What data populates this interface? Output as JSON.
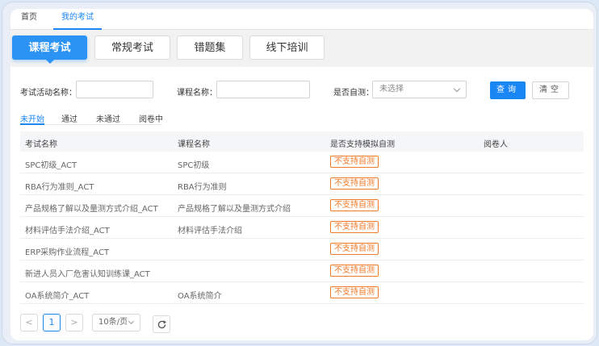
{
  "topnav": {
    "home": "首页",
    "my_exams": "我的考试"
  },
  "tabs": [
    "课程考试",
    "常规考试",
    "错题集",
    "线下培训"
  ],
  "filters": {
    "activity_name_label": "考试活动名称：",
    "course_name_label": "课程名称：",
    "self_test_label": "是否自测：",
    "self_test_value": "未选择",
    "query_button": "查询",
    "clear_button": "清空"
  },
  "subtabs": [
    "未开始",
    "通过",
    "未通过",
    "阅卷中"
  ],
  "table": {
    "headers": [
      "考试名称",
      "课程名称",
      "是否支持模拟自测",
      "阅卷人"
    ],
    "rows": [
      {
        "exam": "SPC初级_ACT",
        "course": "SPC初级",
        "support": "不支持自测"
      },
      {
        "exam": "RBA行为准则_ACT",
        "course": "RBA行为准则",
        "support": "不支持自测"
      },
      {
        "exam": "产品规格了解以及量测方式介绍_ACT",
        "course": "产品规格了解以及量测方式介绍",
        "support": "不支持自测"
      },
      {
        "exam": "材料评估手法介绍_ACT",
        "course": "材料评估手法介绍",
        "support": "不支持自测"
      },
      {
        "exam": "ERP采购作业流程_ACT",
        "course": "",
        "support": "不支持自测"
      },
      {
        "exam": "新进人员入厂危害认知训练课_ACT",
        "course": "",
        "support": "不支持自测"
      },
      {
        "exam": "OA系统简介_ACT",
        "course": "OA系统简介",
        "support": "不支持自测"
      }
    ]
  },
  "pagination": {
    "prev": "<",
    "page": "1",
    "next": ">",
    "page_size": "10条/页"
  },
  "icons": {
    "refresh": "refresh-icon",
    "prev": "chevron-left-icon",
    "next": "chevron-right-icon",
    "dropdown": "chevron-down-icon"
  },
  "colors": {
    "accent": "#1a86f4",
    "tab_active": "#2b93f4",
    "badge": "#f07b2b"
  }
}
